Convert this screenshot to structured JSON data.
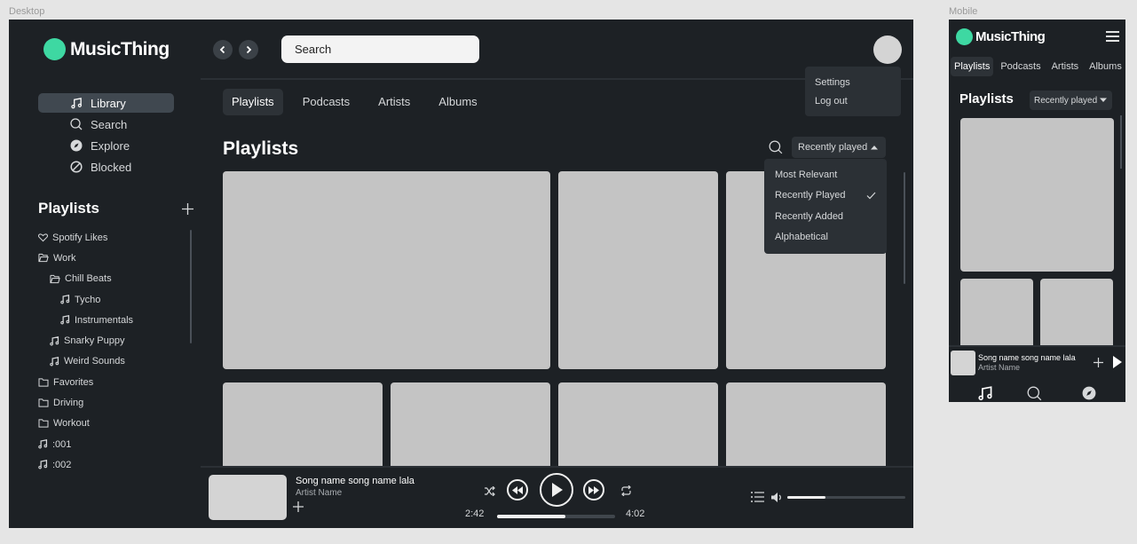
{
  "frames": {
    "desktop_label": "Desktop",
    "mobile_label": "Mobile"
  },
  "colors": {
    "accent": "#3ed8a2",
    "background": "#1d2125",
    "surface": "#2b3035",
    "placeholder": "#c4c4c4"
  },
  "app": {
    "name": "MusicThing"
  },
  "sidebar": {
    "nav": [
      {
        "label": "Library",
        "icon": "music-note-icon",
        "active": true
      },
      {
        "label": "Search",
        "icon": "search-icon",
        "active": false
      },
      {
        "label": "Explore",
        "icon": "compass-icon",
        "active": false
      },
      {
        "label": "Blocked",
        "icon": "blocked-icon",
        "active": false
      }
    ],
    "playlists_title": "Playlists",
    "playlists": [
      {
        "label": "Spotify Likes",
        "icon": "heart-icon"
      },
      {
        "label": "Work",
        "icon": "folder-open-icon"
      },
      {
        "label": "Chill Beats",
        "icon": "folder-open-icon"
      },
      {
        "label": "Tycho",
        "icon": "music-note-icon"
      },
      {
        "label": "Instrumentals",
        "icon": "music-note-icon"
      },
      {
        "label": "Snarky Puppy",
        "icon": "music-note-icon"
      },
      {
        "label": "Weird Sounds",
        "icon": "music-note-icon"
      },
      {
        "label": "Favorites",
        "icon": "folder-icon"
      },
      {
        "label": "Driving",
        "icon": "folder-icon"
      },
      {
        "label": "Workout",
        "icon": "folder-icon"
      },
      {
        "label": ":001",
        "icon": "music-note-icon"
      },
      {
        "label": ":002",
        "icon": "music-note-icon"
      }
    ]
  },
  "header": {
    "search_label": "Search",
    "user_menu": [
      "Settings",
      "Log out"
    ]
  },
  "tabs": [
    "Playlists",
    "Podcasts",
    "Artists",
    "Albums"
  ],
  "main": {
    "title": "Playlists",
    "sort_label": "Recently played",
    "sort_options": [
      {
        "label": "Most Relevant",
        "checked": false
      },
      {
        "label": "Recently Played",
        "checked": true
      },
      {
        "label": "Recently Added",
        "checked": false
      },
      {
        "label": "Alphabetical",
        "checked": false
      }
    ]
  },
  "player": {
    "song": "Song name song name lala",
    "artist": "Artist Name",
    "elapsed": "2:42",
    "duration": "4:02",
    "progress": 0.58,
    "volume": 0.32
  },
  "mobile": {
    "tabs": [
      "Playlists",
      "Podcasts",
      "Artists",
      "Albums"
    ],
    "title": "Playlists",
    "sort_label": "Recently played",
    "song": "Song name song name lala",
    "artist": "Artist Name"
  }
}
